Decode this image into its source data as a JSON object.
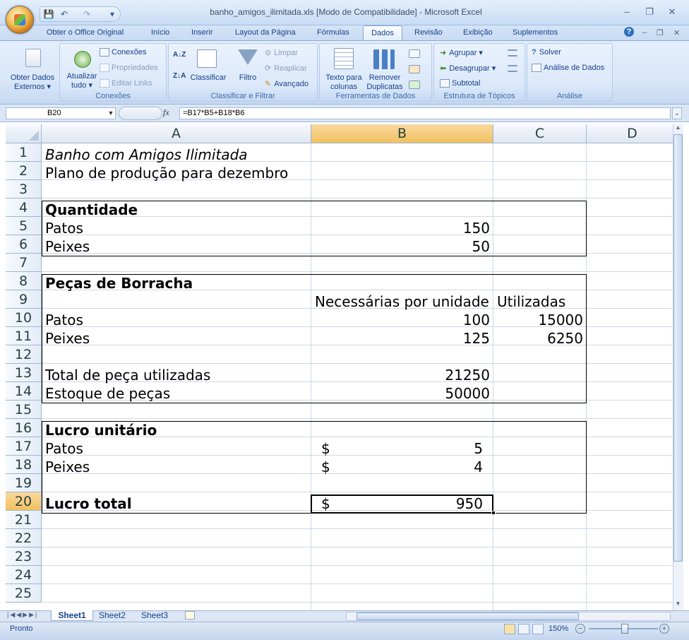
{
  "window": {
    "title": "banho_amigos_ilimitada.xls  [Modo de Compatibilidade] - Microsoft Excel",
    "minimize": "–",
    "restore": "❐",
    "close": "✕"
  },
  "qat": {
    "save": "💾",
    "undo": "↶",
    "redo": "↷",
    "more": "▾"
  },
  "tabs": {
    "office_original": "Obter o Office Original",
    "inicio": "Início",
    "inserir": "Inserir",
    "layout": "Layout da Página",
    "formulas": "Fórmulas",
    "dados": "Dados",
    "revisao": "Revisão",
    "exibicao": "Exibição",
    "suplementos": "Suplementos",
    "help": "?"
  },
  "ribbon": {
    "obter_dados": {
      "line1": "Obter Dados",
      "line2": "Externos ▾"
    },
    "atualizar": {
      "line1": "Atualizar",
      "line2": "tudo ▾"
    },
    "conexoes_btn": "Conexões",
    "propriedades": "Propriedades",
    "editar_links": "Editar Links",
    "group_conexoes": "Conexões",
    "sort_az": "A↓Z",
    "sort_za": "Z↓A",
    "classificar": "Classificar",
    "filtro": "Filtro",
    "limpar": "Limpar",
    "reaplicar": "Reaplicar",
    "avancado": "Avançado",
    "group_classificar": "Classificar e Filtrar",
    "texto_colunas": {
      "line1": "Texto para",
      "line2": "colunas"
    },
    "remover_duplicatas": {
      "line1": "Remover",
      "line2": "Duplicatas"
    },
    "group_ferramentas": "Ferramentas de Dados",
    "agrupar": "Agrupar ▾",
    "desagrupar": "Desagrupar ▾",
    "subtotal": "Subtotal",
    "group_estrutura": "Estrutura de Tópicos",
    "solver": "Solver",
    "analise_dados": "Análise de Dados",
    "group_analise": "Análise"
  },
  "formula_bar": {
    "name_box": "B20",
    "fx": "fx",
    "formula": "=B17*B5+B18*B6"
  },
  "columns": [
    "A",
    "B",
    "C",
    "D"
  ],
  "rows": [
    "1",
    "2",
    "3",
    "4",
    "5",
    "6",
    "7",
    "8",
    "9",
    "10",
    "11",
    "12",
    "13",
    "14",
    "15",
    "16",
    "17",
    "18",
    "19",
    "20",
    "21",
    "22",
    "23",
    "24",
    "25"
  ],
  "cells": {
    "A1": "Banho com Amigos Ilimitada",
    "A2": "Plano de produção para dezembro",
    "A4": "Quantidade",
    "A5": "Patos",
    "B5": "150",
    "A6": "Peixes",
    "B6": "50",
    "A8": "Peças de Borracha",
    "B9": "Necessárias por unidade",
    "C9": "Utilizadas",
    "A10": "Patos",
    "B10": "100",
    "C10": "15000",
    "A11": "Peixes",
    "B11": "125",
    "C11": "6250",
    "A13": "Total de peça utilizadas",
    "B13": "21250",
    "A14": "Estoque de peças",
    "B14": "50000",
    "A16": "Lucro unitário",
    "A17": "Patos",
    "B17_sym": "$",
    "B17": "5",
    "A18": "Peixes",
    "B18_sym": "$",
    "B18": "4",
    "A20": "Lucro total",
    "B20_sym": "$",
    "B20": "950"
  },
  "sheets": [
    "Sheet1",
    "Sheet2",
    "Sheet3"
  ],
  "status": {
    "ready": "Pronto",
    "zoom": "150%"
  }
}
